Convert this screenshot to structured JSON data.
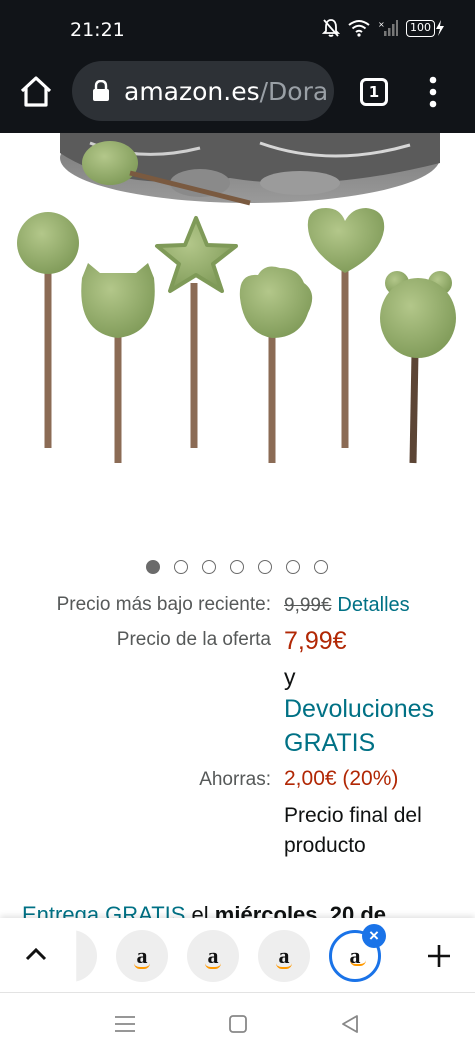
{
  "status_bar": {
    "time": "21:21",
    "battery": "100"
  },
  "browser": {
    "url_host": "amazon.es",
    "url_path": "/Dora",
    "tab_count": "1"
  },
  "carousel": {
    "total": 7,
    "active_index": 0
  },
  "pricing": {
    "recent_low_label": "Precio más bajo reciente:",
    "recent_low_value": "9,99€",
    "details_link": "Detalles",
    "deal_label": "Precio de la oferta",
    "deal_price": "7,99€",
    "and_text": "y",
    "returns_line1": "Devoluciones",
    "returns_line2": "GRATIS",
    "savings_label": "Ahorras:",
    "savings_value": "2,00€ (20%)",
    "final_line1": "Precio final del",
    "final_line2": "producto"
  },
  "delivery": {
    "link_text": "Entrega GRATIS",
    "mid_text": " el ",
    "date_text": "miércoles, 20 de"
  },
  "tab_strip": {
    "chip_letter": "a"
  },
  "colors": {
    "accent_teal": "#007185",
    "price_red": "#b12704",
    "tab_blue": "#1a73e8"
  }
}
